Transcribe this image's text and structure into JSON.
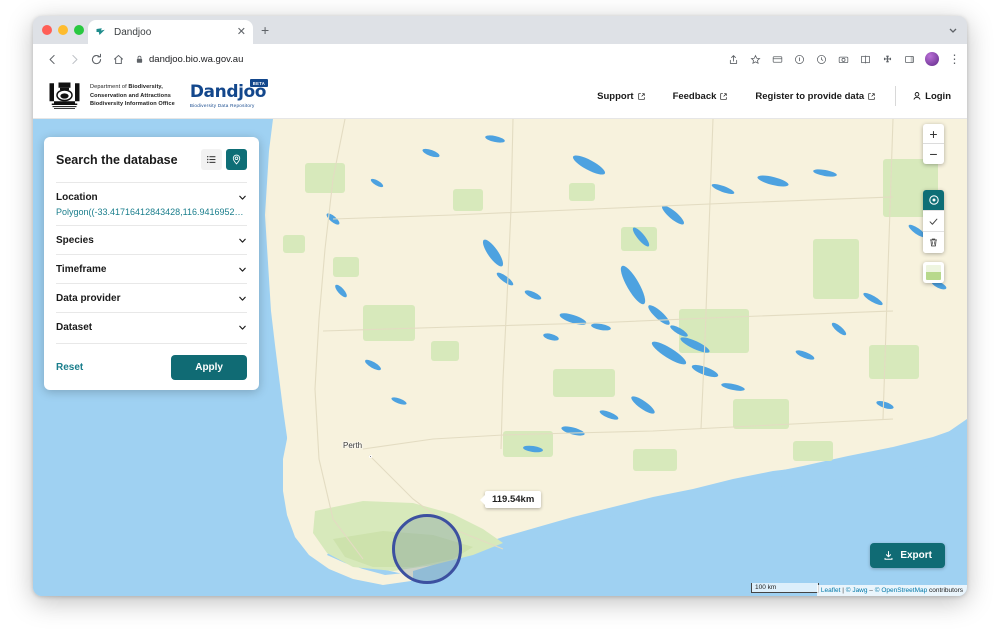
{
  "browser": {
    "tab": {
      "title": "Dandjoo",
      "favicon_icon": "dandjoo-bird-favicon",
      "close_icon": "close-icon"
    },
    "new_tab_icon": "plus-icon",
    "tabstrip_chevron_icon": "chevron-down-icon",
    "nav": {
      "back_icon": "arrow-left-icon",
      "forward_icon": "arrow-right-icon",
      "reload_icon": "reload-icon",
      "home_icon": "home-icon"
    },
    "url": "dandjoo.bio.wa.gov.au",
    "lock_icon": "lock-icon",
    "toolbar_icons": [
      "share-icon",
      "bookmark-star-icon",
      "card-icon",
      "info-circle-icon",
      "history-clock-icon",
      "camera-icon",
      "split-screen-icon",
      "extensions-puzzle-icon",
      "sidebar-panel-icon"
    ],
    "profile_avatar": "profile-avatar",
    "menu_icon": "kebab-menu-icon"
  },
  "site_header": {
    "crest_icon": "wa-government-crest",
    "department": {
      "line1_prefix": "Department of ",
      "line1_bold": "Biodiversity,",
      "line2_bold": "Conservation and Attractions",
      "line3_bold": "Biodiversity Information Office"
    },
    "logo": {
      "wordmark": "Dandjoo",
      "badge": "BETA",
      "tagline": "Biodiversity Data Repository"
    },
    "nav_links": [
      {
        "label": "Support",
        "icon": "external-link-icon"
      },
      {
        "label": "Feedback",
        "icon": "external-link-icon"
      },
      {
        "label": "Register to provide data",
        "icon": "external-link-icon"
      }
    ],
    "login": {
      "label": "Login",
      "icon": "user-icon"
    }
  },
  "search_panel": {
    "title": "Search the database",
    "view_toggle": {
      "list_icon": "list-view-icon",
      "map_icon": "map-pin-icon",
      "active": "map"
    },
    "filters": [
      {
        "label": "Location",
        "value": "Polygon((-33.41716412843428,116.94169521...",
        "chevron_icon": "chevron-down-icon"
      },
      {
        "label": "Species",
        "value": "",
        "chevron_icon": "chevron-down-icon"
      },
      {
        "label": "Timeframe",
        "value": "",
        "chevron_icon": "chevron-down-icon"
      },
      {
        "label": "Data provider",
        "value": "",
        "chevron_icon": "chevron-down-icon"
      },
      {
        "label": "Dataset",
        "value": "",
        "chevron_icon": "chevron-down-icon"
      }
    ],
    "reset_label": "Reset",
    "apply_label": "Apply"
  },
  "map": {
    "city_label": "Perth",
    "distance_tooltip": "119.54km",
    "zoom_in_label": "+",
    "zoom_out_label": "−",
    "controls": [
      {
        "name": "draw-circle-tool",
        "icon": "circle-target-icon",
        "active": true
      },
      {
        "name": "confirm-tool",
        "icon": "check-icon",
        "active": false
      },
      {
        "name": "delete-tool",
        "icon": "trash-icon",
        "active": false
      }
    ],
    "layers_icon": "layers-thumbnail-icon",
    "scale_label": "100 km",
    "attribution": {
      "leaflet": "Leaflet",
      "separator": " | ",
      "jawg": "© Jawg",
      "dash": " – ",
      "osm": "© OpenStreetMap",
      "contributors": " contributors"
    },
    "export_label": "Export",
    "export_icon": "download-icon",
    "colors": {
      "ocean": "#9fd1f2",
      "land": "#f7f2dd",
      "vegetation": "#d7e9bb",
      "water_inland": "#4da2e0",
      "circle_stroke": "#3c50a0",
      "circle_fill": "rgba(120,150,160,0.34)",
      "accent_teal": "#106b74",
      "link_teal": "#1a7e8c",
      "brand_blue": "#13478c"
    }
  }
}
